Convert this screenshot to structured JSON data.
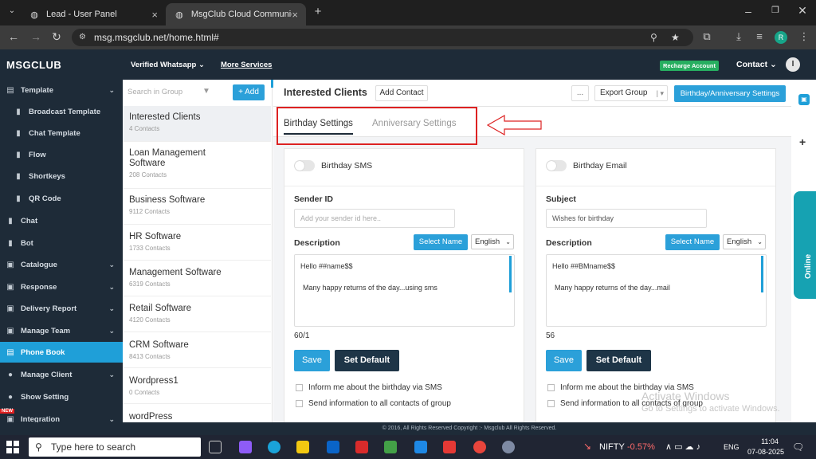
{
  "browser": {
    "tabs": [
      {
        "title": "Lead - User Panel",
        "icon": "globe-icon"
      },
      {
        "title": "MsgClub Cloud Communication",
        "icon": "globe-icon"
      }
    ],
    "new_tab": "+",
    "url": "msg.msgclub.net/home.html#",
    "profile_initial": "R"
  },
  "app": {
    "logo": "MSGCLUB",
    "topnav": [
      {
        "label": "Verified Whatsapp ⌄"
      },
      {
        "label": "More Services"
      }
    ],
    "recharge": "Recharge Account",
    "contact": "Contact ⌄",
    "user_initial": "I"
  },
  "sidebar": {
    "items": [
      {
        "label": "Template",
        "icon": "template-icon",
        "chevron": "⌄"
      },
      {
        "label": "Broadcast Template",
        "icon": "doc-icon"
      },
      {
        "label": "Chat Template",
        "icon": "doc-icon"
      },
      {
        "label": "Flow",
        "icon": "doc-icon"
      },
      {
        "label": "Shortkeys",
        "icon": "doc-icon"
      },
      {
        "label": "QR Code",
        "icon": "doc-icon"
      },
      {
        "label": "Chat",
        "icon": "doc-icon"
      },
      {
        "label": "Bot",
        "icon": "doc-icon"
      },
      {
        "label": "Catalogue",
        "icon": "catalogue-icon",
        "chevron": "⌄"
      },
      {
        "label": "Response",
        "icon": "response-icon",
        "chevron": "⌄"
      },
      {
        "label": "Delivery Report",
        "icon": "report-icon",
        "chevron": "⌄"
      },
      {
        "label": "Manage Team",
        "icon": "team-icon",
        "chevron": "⌄"
      },
      {
        "label": "Phone Book",
        "icon": "phonebook-icon"
      },
      {
        "label": "Manage Client",
        "icon": "client-icon",
        "chevron": "⌄"
      },
      {
        "label": "Show Setting",
        "icon": "users-icon"
      },
      {
        "label": "Integration",
        "icon": "integration-icon",
        "chevron": "⌄"
      }
    ],
    "new_badge": "NEW"
  },
  "groups": {
    "search_placeholder": "Search in Group",
    "add_label": "+ Add",
    "items": [
      {
        "name": "Interested Clients",
        "count": "4 Contacts"
      },
      {
        "name": "Loan Management Software",
        "count": "208 Contacts"
      },
      {
        "name": "Business Software",
        "count": "9112 Contacts"
      },
      {
        "name": "HR Software",
        "count": "1733 Contacts"
      },
      {
        "name": "Management Software",
        "count": "6319 Contacts"
      },
      {
        "name": "Retail Software",
        "count": "4120 Contacts"
      },
      {
        "name": "CRM Software",
        "count": "8413 Contacts"
      },
      {
        "name": "Wordpress1",
        "count": "0 Contacts"
      },
      {
        "name": "wordPress",
        "count": ""
      }
    ]
  },
  "main": {
    "group_title": "Interested Clients",
    "add_contact": "Add Contact",
    "dots": "...",
    "export_group": "Export Group",
    "birthday_settings_btn": "Birthday/Anniversary Settings",
    "tabs": {
      "birthday": "Birthday Settings",
      "anniversary": "Anniversary Settings"
    }
  },
  "sms_card": {
    "toggle_label": "Birthday SMS",
    "sender_label": "Sender ID",
    "sender_placeholder": "Add your sender id here..",
    "desc_label": "Description",
    "select_name": "Select Name",
    "language": "English",
    "message_line1": "Hello  ##name$$",
    "message_line2": "Many happy returns of the day...using sms",
    "counter": "60/1",
    "save": "Save",
    "set_default": "Set Default",
    "check1": "Inform me about the birthday via SMS",
    "check2": "Send information to all contacts of group"
  },
  "email_card": {
    "toggle_label": "Birthday Email",
    "subject_label": "Subject",
    "subject_value": "Wishes for birthday",
    "desc_label": "Description",
    "select_name": "Select Name",
    "language": "English",
    "message_line1": "Hello ##BMname$$",
    "message_line2": "Many happy returns of the day...mail",
    "counter": "56",
    "save": "Save",
    "set_default": "Set Default",
    "check1": "Inform me about the birthday via SMS",
    "check2": "Send information to all contacts of group"
  },
  "rail": {
    "online": "Online",
    "plus": "+"
  },
  "footer": "© 2016, All Rights Reserved Copyright :- Msgclub All Rights Reserved.",
  "watermark": {
    "line1": "Activate Windows",
    "line2": "Go to Settings to activate Windows."
  },
  "taskbar": {
    "search_placeholder": "Type here to search",
    "nifty_label": "NIFTY",
    "nifty_value": "-0.57%",
    "language": "ENG",
    "time": "11:04",
    "date": "07-08-2025"
  },
  "colors": {
    "accent": "#2ba0d9",
    "dark": "#1e2b38",
    "highlight": "#d22222"
  }
}
